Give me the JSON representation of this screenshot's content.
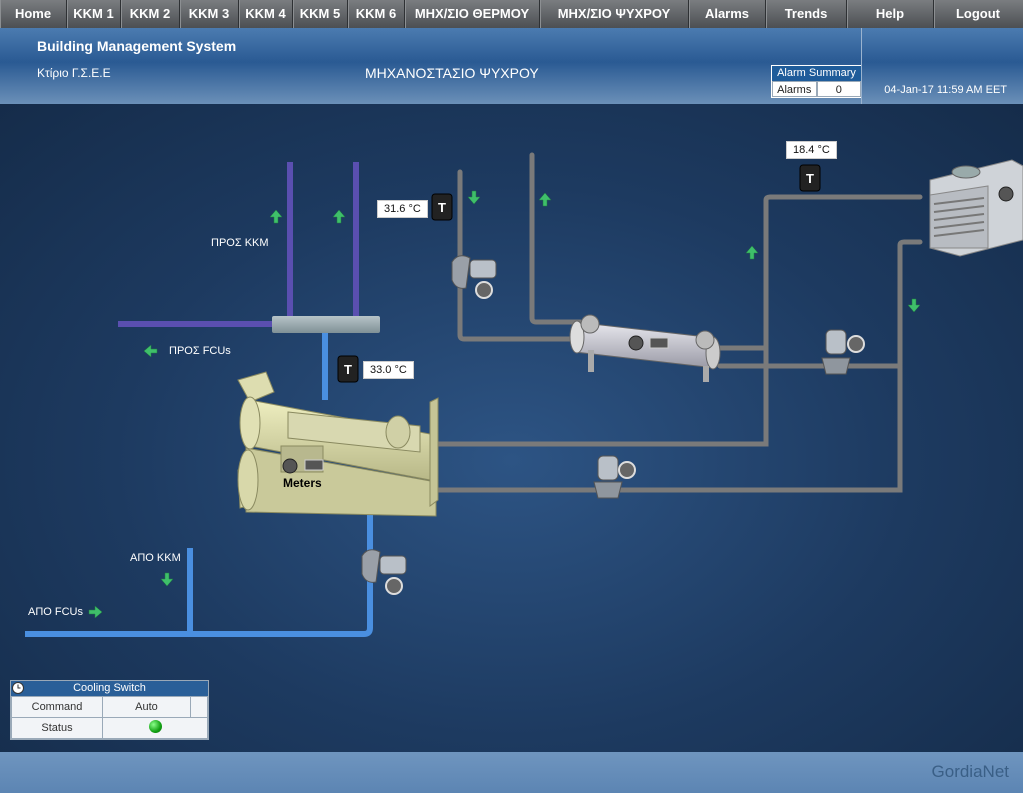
{
  "nav": [
    "Home",
    "KKM 1",
    "KKM 2",
    "KKM 3",
    "KKM 4",
    "KKM 5",
    "KKM 6",
    "ΜΗΧ/ΣΙΟ ΘΕΡΜΟΥ",
    "ΜΗΧ/ΣΙΟ ΨΥΧΡΟΥ",
    "Alarms",
    "Trends",
    "Help",
    "Logout"
  ],
  "header": {
    "title": "Building Management System",
    "building": "Κτίριο Γ.Σ.Ε.Ε",
    "page_title": "ΜΗΧΑΝΟΣΤΑΣΙΟ ΨΥΧΡΟΥ",
    "alarm_summary": {
      "title": "Alarm Summary",
      "label": "Alarms",
      "count": "0"
    },
    "datetime": "04-Jan-17 11:59 AM EET"
  },
  "diagram": {
    "labels": {
      "pros_kkm": "ΠΡΟΣ ΚΚΜ",
      "pros_fcus": "ΠΡΟΣ FCUs",
      "apo_kkm": "ΑΠΟ ΚΚΜ",
      "apo_fcus": "ΑΠΟ FCUs",
      "meters": "Meters"
    },
    "temps": {
      "t1": "31.6 °C",
      "t2": "33.0 °C",
      "t3": "18.4 °C"
    },
    "sensor_glyph": "T"
  },
  "cooling_switch": {
    "title": "Cooling Switch",
    "command_label": "Command",
    "command_value": "Auto",
    "status_label": "Status",
    "status_color": "#12a012"
  },
  "footer": {
    "logo_mark": "",
    "logo_text": "GordiaNet"
  },
  "colors": {
    "supply_pipe": "#5a4fb0",
    "return_pipe": "#4a8fe0",
    "condenser_pipe": "#8a8a8a",
    "arrow": "#3fbf6a"
  }
}
